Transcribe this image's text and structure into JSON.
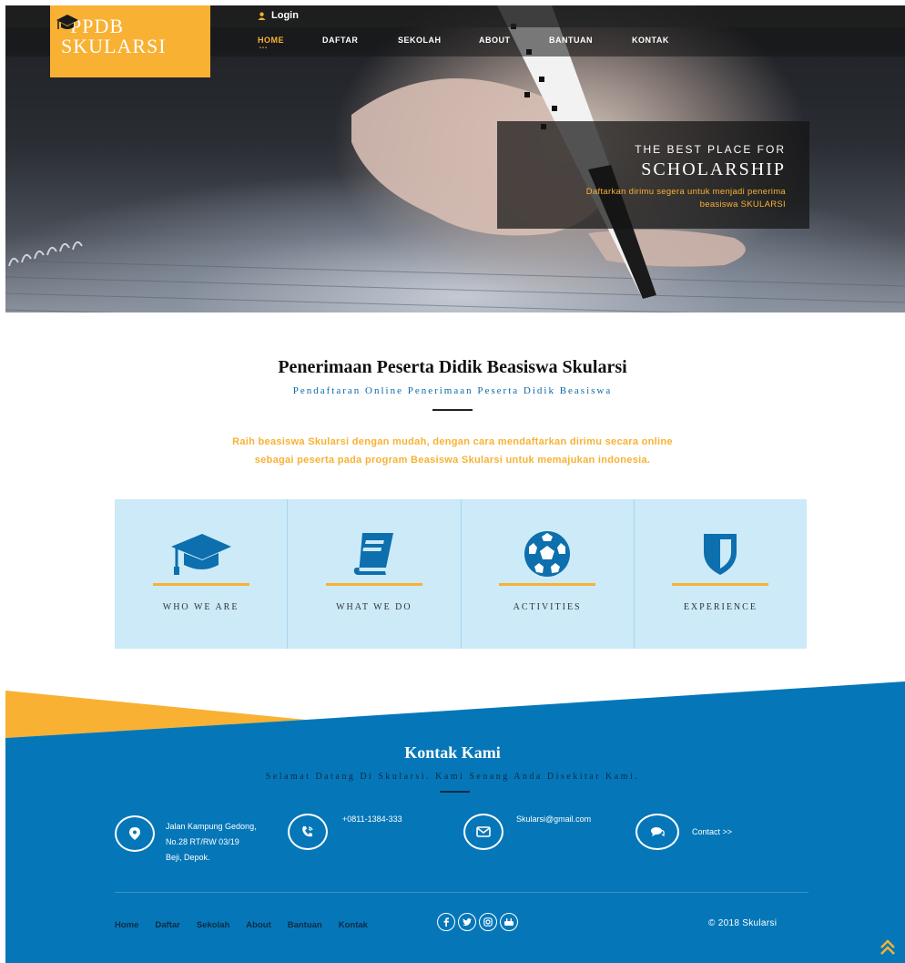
{
  "header": {
    "logo_line1": "PPDB",
    "logo_line2": "SKULARSI",
    "login_label": "Login",
    "nav": [
      {
        "label": "HOME",
        "active": true
      },
      {
        "label": "DAFTAR",
        "active": false
      },
      {
        "label": "SEKOLAH",
        "active": false
      },
      {
        "label": "ABOUT",
        "active": false
      },
      {
        "label": "BANTUAN",
        "active": false
      },
      {
        "label": "KONTAK",
        "active": false
      }
    ]
  },
  "hero": {
    "small": "THE BEST PLACE FOR",
    "big": "SCHOLARSHIP",
    "sub_line1": "Daftarkan dirimu segera untuk menjadi penerima",
    "sub_line2": "beasiswa SKULARSI"
  },
  "intro": {
    "title": "Penerimaan Peserta Didik Beasiswa Skularsi",
    "subtitle": "Pendaftaran Online Penerimaan Peserta Didik Beasiswa",
    "text_line1": "Raih beasiswa Skularsi dengan mudah, dengan cara mendaftarkan dirimu secara online",
    "text_line2": "sebagai peserta pada program Beasiswa Skularsi untuk memajukan indonesia."
  },
  "features": [
    {
      "label": "WHO WE ARE",
      "icon": "graduation-cap-icon"
    },
    {
      "label": "WHAT WE DO",
      "icon": "book-icon"
    },
    {
      "label": "ACTIVITIES",
      "icon": "soccer-ball-icon"
    },
    {
      "label": "EXPERIENCE",
      "icon": "shield-icon"
    }
  ],
  "contact": {
    "title": "Kontak Kami",
    "subtitle": "Selamat Datang Di Skularsi. Kami Senang Anda Disekitar Kami.",
    "address_line1": "Jalan Kampung Gedong,",
    "address_line2": "No.28 RT/RW 03/19",
    "address_line3": "Beji, Depok.",
    "phone": "+0811-1384-333",
    "email": "Skularsi@gmail.com",
    "contact_link": "Contact >>"
  },
  "footer": {
    "nav": [
      "Home",
      "Daftar",
      "Sekolah",
      "About",
      "Bantuan",
      "Kontak"
    ],
    "copyright": "© 2018 Skularsi"
  },
  "colors": {
    "accent_orange": "#f8b133",
    "footer_blue": "#0577b8",
    "feature_bg": "#cceaf8",
    "icon_blue": "#0d6fad"
  }
}
